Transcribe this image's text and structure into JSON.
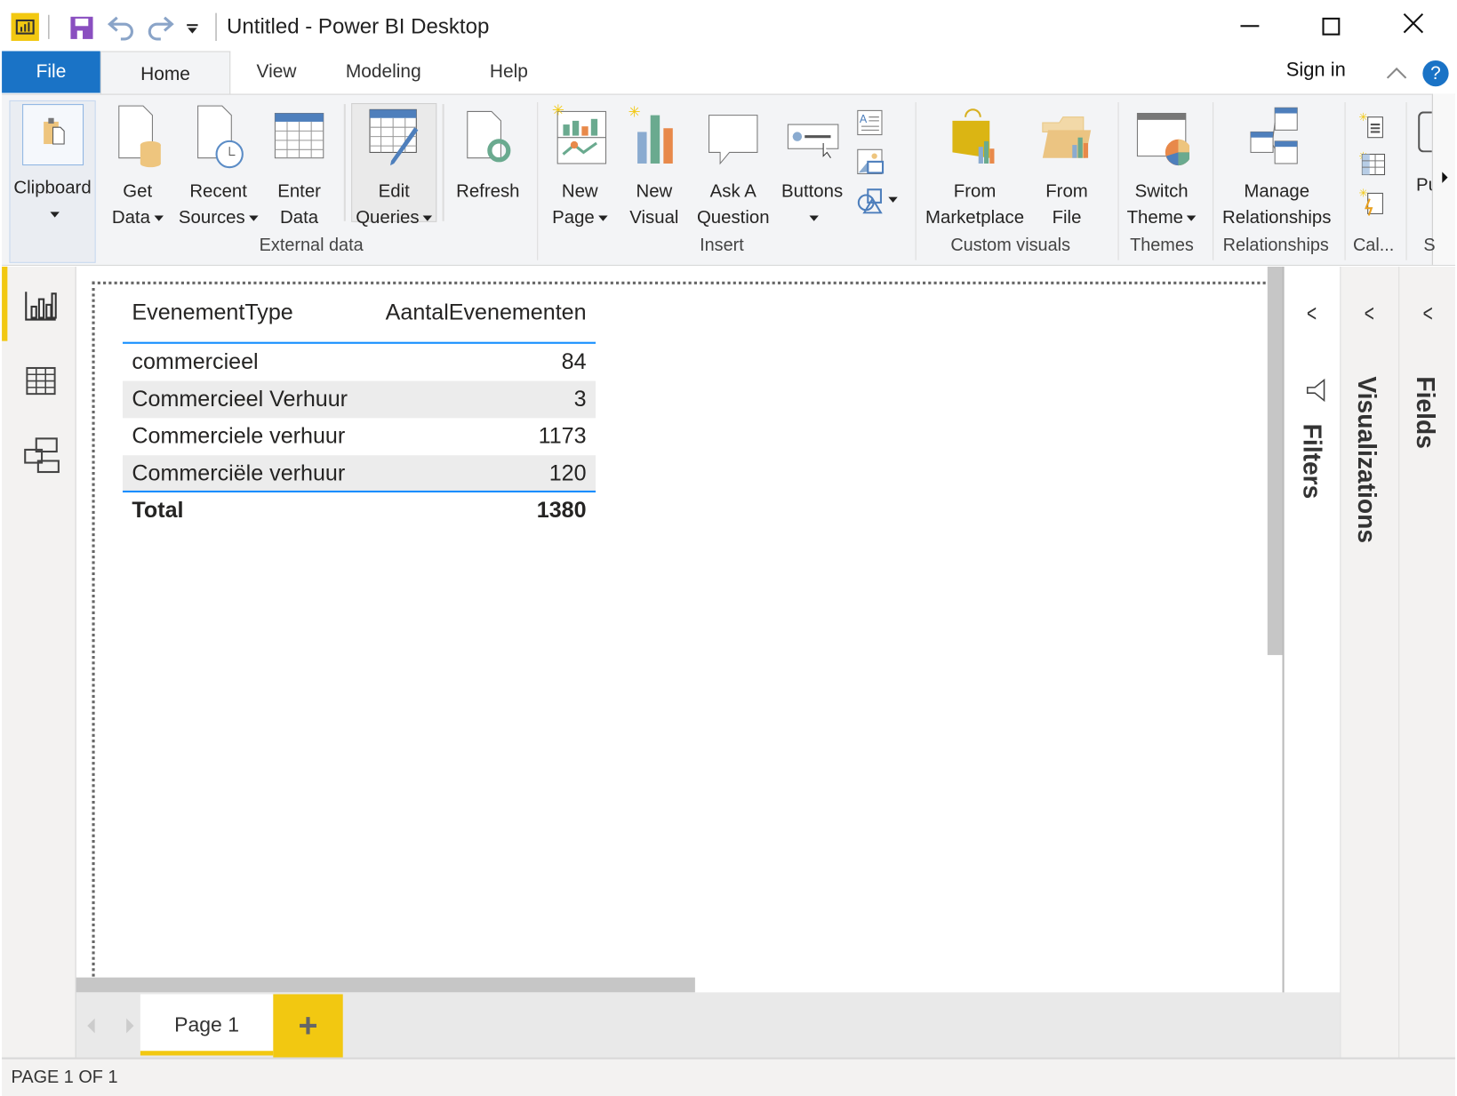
{
  "window": {
    "title": "Untitled - Power BI Desktop",
    "controls": [
      "minimize",
      "maximize",
      "close"
    ]
  },
  "menu": {
    "tabs": [
      "File",
      "Home",
      "View",
      "Modeling",
      "Help"
    ],
    "active": "Home",
    "sign_in": "Sign in",
    "help": "?"
  },
  "ribbon": {
    "clipboard": "Clipboard",
    "get_data": [
      "Get",
      "Data"
    ],
    "recent_sources": [
      "Recent",
      "Sources"
    ],
    "enter_data": [
      "Enter",
      "Data"
    ],
    "edit_queries": [
      "Edit",
      "Queries"
    ],
    "refresh": "Refresh",
    "new_page": [
      "New",
      "Page"
    ],
    "new_visual": [
      "New",
      "Visual"
    ],
    "ask_question": [
      "Ask A",
      "Question"
    ],
    "buttons": "Buttons",
    "from_marketplace": [
      "From",
      "Marketplace"
    ],
    "from_file": [
      "From",
      "File"
    ],
    "switch_theme": [
      "Switch",
      "Theme"
    ],
    "manage_relationships": [
      "Manage",
      "Relationships"
    ],
    "publish_partial": "Pu",
    "groups": {
      "external_data": "External data",
      "insert": "Insert",
      "custom_visuals": "Custom visuals",
      "themes": "Themes",
      "relationships": "Relationships",
      "calculations": "Cal...",
      "share_partial": "S"
    }
  },
  "table": {
    "columns": [
      "EvenementType",
      "AantalEvenementen"
    ],
    "rows": [
      {
        "type": "commercieel",
        "count": "84"
      },
      {
        "type": "Commercieel Verhuur",
        "count": "3"
      },
      {
        "type": "Commerciele verhuur",
        "count": "1173"
      },
      {
        "type": "Commerciële verhuur",
        "count": "120"
      }
    ],
    "total": {
      "label": "Total",
      "count": "1380"
    }
  },
  "panes": {
    "filters": "Filters",
    "visualizations": "Visualizations",
    "fields": "Fields"
  },
  "pages": {
    "tabs": [
      "Page 1"
    ],
    "add": "+"
  },
  "status": "PAGE 1 OF 1",
  "colors": {
    "accent_blue": "#1a73c6",
    "powerbi_yellow": "#f2c811",
    "table_line": "#118dff"
  }
}
